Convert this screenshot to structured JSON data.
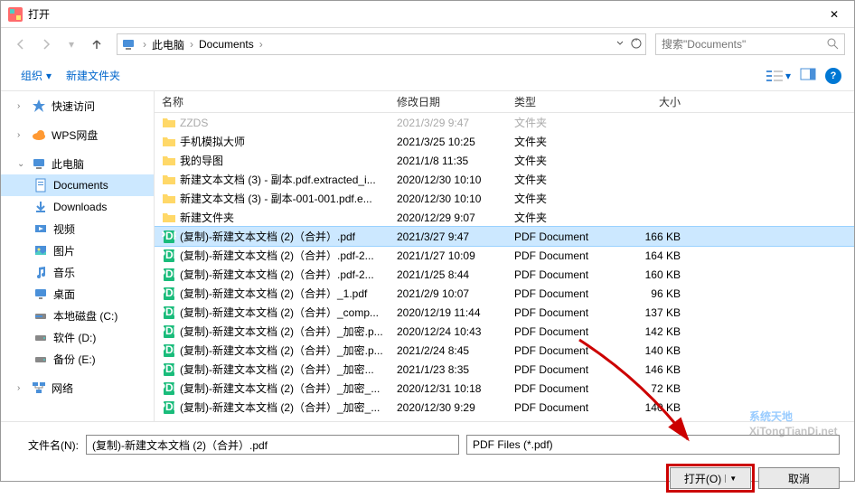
{
  "window": {
    "title": "打开",
    "close_glyph": "✕"
  },
  "nav": {
    "breadcrumb": [
      "此电脑",
      "Documents"
    ],
    "search_placeholder": "搜索\"Documents\""
  },
  "toolbar": {
    "organize": "组织",
    "new_folder": "新建文件夹"
  },
  "sidebar": {
    "quick_access": "快速访问",
    "wps": "WPS网盘",
    "this_pc": "此电脑",
    "documents": "Documents",
    "downloads": "Downloads",
    "videos": "视频",
    "pictures": "图片",
    "music": "音乐",
    "desktop": "桌面",
    "drive_c": "本地磁盘 (C:)",
    "drive_d": "软件 (D:)",
    "drive_e": "备份 (E:)",
    "network": "网络"
  },
  "columns": {
    "name": "名称",
    "date": "修改日期",
    "type": "类型",
    "size": "大小"
  },
  "files": [
    {
      "icon": "folder",
      "name": "ZZDS",
      "date": "2021/3/29 9:47",
      "type": "文件夹",
      "size": "",
      "faded": true
    },
    {
      "icon": "folder",
      "name": "手机模拟大师",
      "date": "2021/3/25 10:25",
      "type": "文件夹",
      "size": ""
    },
    {
      "icon": "folder",
      "name": "我的导图",
      "date": "2021/1/8 11:35",
      "type": "文件夹",
      "size": ""
    },
    {
      "icon": "folder",
      "name": "新建文本文档 (3) - 副本.pdf.extracted_i...",
      "date": "2020/12/30 10:10",
      "type": "文件夹",
      "size": ""
    },
    {
      "icon": "folder",
      "name": "新建文本文档 (3) - 副本-001-001.pdf.e...",
      "date": "2020/12/30 10:10",
      "type": "文件夹",
      "size": ""
    },
    {
      "icon": "folder",
      "name": "新建文件夹",
      "date": "2020/12/29 9:07",
      "type": "文件夹",
      "size": ""
    },
    {
      "icon": "pdf",
      "name": "(复制)-新建文本文档 (2)（合并）.pdf",
      "date": "2021/3/27 9:47",
      "type": "PDF Document",
      "size": "166 KB",
      "selected": true
    },
    {
      "icon": "pdf",
      "name": "(复制)-新建文本文档 (2)（合并）.pdf-2...",
      "date": "2021/1/27 10:09",
      "type": "PDF Document",
      "size": "164 KB"
    },
    {
      "icon": "pdf",
      "name": "(复制)-新建文本文档 (2)（合并）.pdf-2...",
      "date": "2021/1/25 8:44",
      "type": "PDF Document",
      "size": "160 KB"
    },
    {
      "icon": "pdf",
      "name": "(复制)-新建文本文档 (2)（合并）_1.pdf",
      "date": "2021/2/9 10:07",
      "type": "PDF Document",
      "size": "96 KB"
    },
    {
      "icon": "pdf",
      "name": "(复制)-新建文本文档 (2)（合并）_comp...",
      "date": "2020/12/19 11:44",
      "type": "PDF Document",
      "size": "137 KB"
    },
    {
      "icon": "pdf",
      "name": "(复制)-新建文本文档 (2)（合并）_加密.p...",
      "date": "2020/12/24 10:43",
      "type": "PDF Document",
      "size": "142 KB"
    },
    {
      "icon": "pdf",
      "name": "(复制)-新建文本文档 (2)（合并）_加密.p...",
      "date": "2021/2/24 8:45",
      "type": "PDF Document",
      "size": "140 KB"
    },
    {
      "icon": "pdf",
      "name": "(复制)-新建文本文档 (2)（合并）_加密...",
      "date": "2021/1/23 8:35",
      "type": "PDF Document",
      "size": "146 KB"
    },
    {
      "icon": "pdf",
      "name": "(复制)-新建文本文档 (2)（合并）_加密_...",
      "date": "2020/12/31 10:18",
      "type": "PDF Document",
      "size": "72 KB"
    },
    {
      "icon": "pdf",
      "name": "(复制)-新建文本文档 (2)（合并）_加密_...",
      "date": "2020/12/30 9:29",
      "type": "PDF Document",
      "size": "140 KB"
    }
  ],
  "filename": {
    "label": "文件名(N):",
    "value": "(复制)-新建文本文档 (2)（合并）.pdf",
    "filter": "PDF Files (*.pdf)"
  },
  "buttons": {
    "open": "打开(O)",
    "cancel": "取消"
  },
  "watermark": "系统天地"
}
